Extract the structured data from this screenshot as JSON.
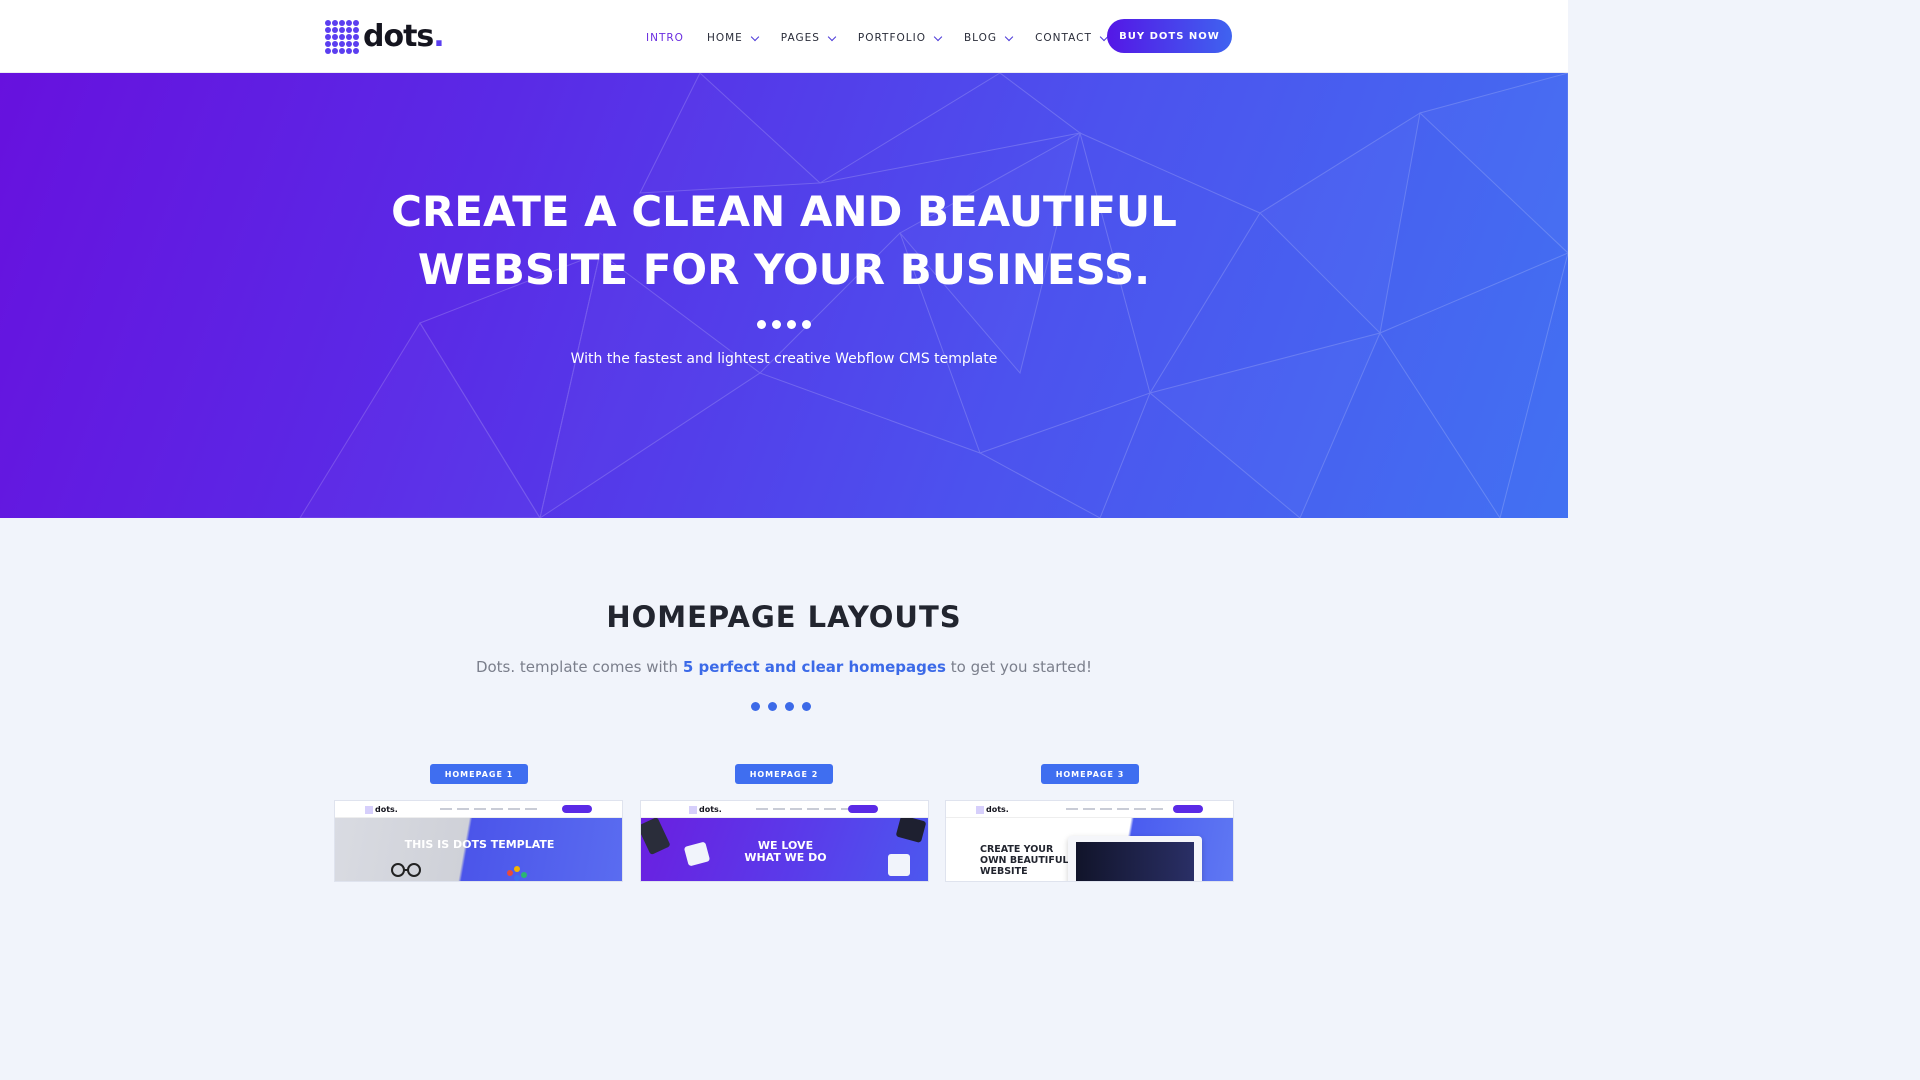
{
  "navbar": {
    "brand": "dots",
    "brand_dot": ".",
    "items": [
      {
        "label": "INTRO",
        "active": true,
        "dropdown": false
      },
      {
        "label": "HOME",
        "active": false,
        "dropdown": true
      },
      {
        "label": "PAGES",
        "active": false,
        "dropdown": true
      },
      {
        "label": "PORTFOLIO",
        "active": false,
        "dropdown": true
      },
      {
        "label": "BLOG",
        "active": false,
        "dropdown": true
      },
      {
        "label": "CONTACT",
        "active": false,
        "dropdown": true
      }
    ],
    "cta": "BUY DOTS NOW"
  },
  "hero": {
    "title_line1": "CREATE A CLEAN AND BEAUTIFUL",
    "title_line2": "WEBSITE FOR YOUR BUSINESS.",
    "subtitle": "With the fastest and lightest creative Webflow CMS template"
  },
  "layouts": {
    "title": "HOMEPAGE LAYOUTS",
    "subtitle_pre": "Dots. template comes with ",
    "subtitle_highlight": "5 perfect and clear homepages",
    "subtitle_post": " to get you started!",
    "cards": [
      {
        "badge": "HOMEPAGE 1",
        "preview_brand": "dots.",
        "preview_heading": "THIS IS DOTS TEMPLATE"
      },
      {
        "badge": "HOMEPAGE 2",
        "preview_brand": "dots.",
        "preview_heading_line1": "WE LOVE",
        "preview_heading_line2": "WHAT WE DO"
      },
      {
        "badge": "HOMEPAGE 3",
        "preview_brand": "dots.",
        "preview_heading_line1": "CREATE YOUR",
        "preview_heading_line2": "OWN BEAUTIFUL",
        "preview_heading_line3": "WEBSITE"
      }
    ]
  },
  "colors": {
    "accent_purple": "#5417e6",
    "accent_blue": "#3f6ef0",
    "hero_start": "#6711de",
    "hero_end": "#4271f2"
  },
  "icons": [
    "logo-dot-grid-icon",
    "chevron-down-icon"
  ]
}
